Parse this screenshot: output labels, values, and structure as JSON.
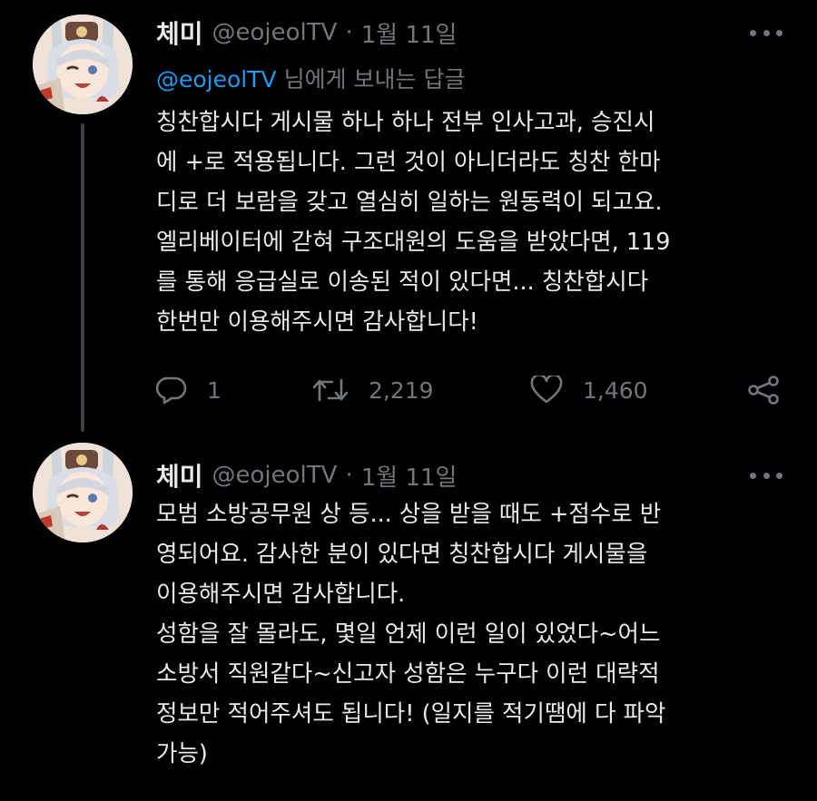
{
  "colors": {
    "background": "#000000",
    "text": "#e7e9ea",
    "secondary": "#71767b",
    "mention": "#1d9bf0",
    "thread_line": "#3b4046"
  },
  "tweets": [
    {
      "name": "체미",
      "handle": "@eojeolTV",
      "separator": "·",
      "date": "1월 11일",
      "more_icon": "more-horizontal-icon",
      "reply_to": {
        "mention": "@eojeolTV",
        "suffix": " 님에게 보내는 답글"
      },
      "body_lines": [
        "칭찬합시다 게시물 하나 하나 전부 인사고과, 승진시",
        "에 +로 적용됩니다. 그런 것이 아니더라도 칭찬 한마",
        "디로 더 보람을 갖고 열심히 일하는 원동력이 되고요.",
        "엘리베이터에 갇혀 구조대원의 도움을 받았다면, 119",
        "를 통해 응급실로 이송된 적이 있다면... 칭찬합시다",
        "한번만 이용해주시면 감사합니다!"
      ],
      "actions": {
        "reply_count": "1",
        "retweet_count": "2,219",
        "like_count": "1,460"
      }
    },
    {
      "name": "체미",
      "handle": "@eojeolTV",
      "separator": "·",
      "date": "1월 11일",
      "more_icon": "more-horizontal-icon",
      "body_lines": [
        "모범 소방공무원 상 등... 상을 받을 때도 +점수로 반",
        "영되어요. 감사한 분이 있다면 칭찬합시다 게시물을",
        "이용해주시면 감사합니다.",
        "성함을 잘 몰라도, 몇일 언제 이런 일이 있었다~어느",
        "소방서 직원같다~신고자 성함은 누구다 이런 대략적",
        "정보만 적어주셔도 됩니다! (일지를 적기땜에 다 파악",
        "가능)"
      ]
    }
  ]
}
